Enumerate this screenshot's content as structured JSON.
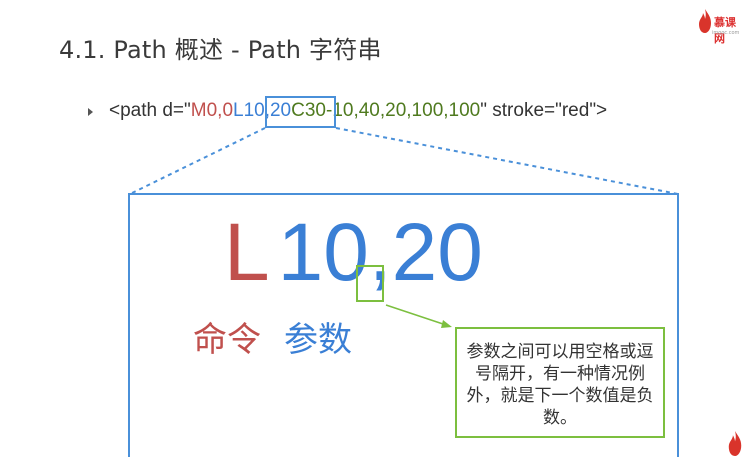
{
  "slide": {
    "title": "4.1. Path 概述 - Path 字符串"
  },
  "logo": {
    "text": "慕课网",
    "subtext": "imooc.com",
    "icon": "flame-icon",
    "color": "#d9342b"
  },
  "code": {
    "prefix": "<path d=\"",
    "move": "M0,0",
    "line": "L10,20",
    "curve": "C30-10,40,20,100,100",
    "suffix": "\" stroke=\"red\">"
  },
  "detail": {
    "command": "L",
    "args": "10,20",
    "command_label": "命令",
    "args_label": "参数"
  },
  "note": {
    "text": "参数之间可以用空格或逗号隔开，有一种情况例外，就是下一个数值是负数。"
  },
  "colors": {
    "command_red": "#c0504d",
    "args_blue": "#3a7fd5",
    "highlight_green": "#7cbf3f",
    "box_blue": "#4a90d9"
  }
}
